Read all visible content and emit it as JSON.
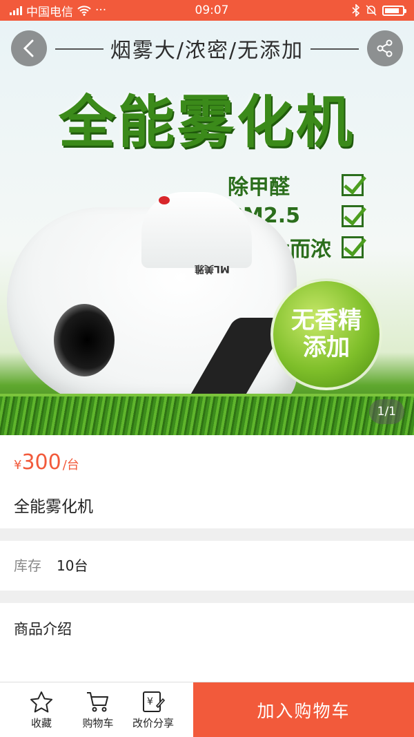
{
  "status_bar": {
    "network_label": "中国电信",
    "dots": "···",
    "time": "09:07",
    "battery_level": 0.85
  },
  "hero": {
    "tagline": "烟雾大/浓密/无添加",
    "title": "全能雾化机",
    "features": [
      "除甲醛",
      "PM2.5",
      "烟雾大而浓"
    ],
    "badge_line1": "无香精",
    "badge_line2": "添加",
    "device_brand": "ML美雅",
    "page_indicator": "1/1"
  },
  "product": {
    "currency": "¥",
    "price": "300",
    "unit": "/台",
    "name": "全能雾化机"
  },
  "stock": {
    "label": "库存",
    "value": "10台"
  },
  "intro": {
    "label": "商品介绍"
  },
  "bottom_bar": {
    "favorite_label": "收藏",
    "cart_label": "购物车",
    "share_label": "改价分享",
    "add_to_cart_label": "加入购物车"
  },
  "colors": {
    "accent": "#f25a3b",
    "divider": "#efefef"
  }
}
